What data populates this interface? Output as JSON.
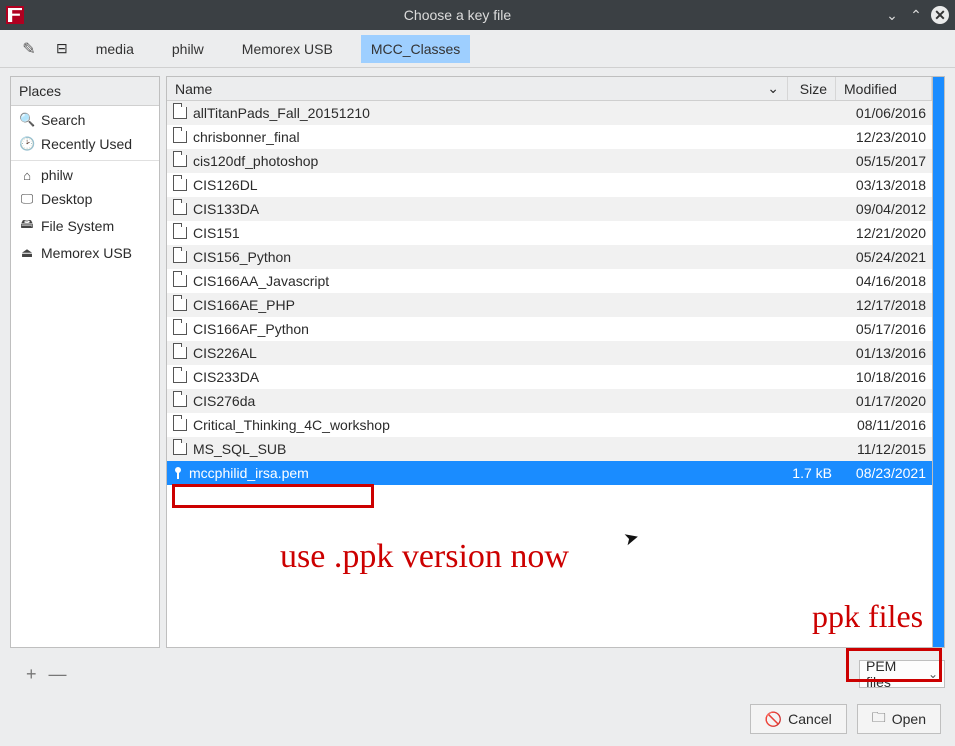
{
  "titlebar": {
    "title": "Choose a key file"
  },
  "breadcrumb": {
    "items": [
      "media",
      "philw",
      "Memorex USB",
      "MCC_Classes"
    ],
    "active_index": 3
  },
  "places": {
    "header": "Places",
    "items": [
      {
        "icon": "search-icon",
        "label": "Search"
      },
      {
        "icon": "recent-icon",
        "label": "Recently Used"
      },
      {
        "icon": "home-icon",
        "label": "philw",
        "separator": true
      },
      {
        "icon": "desktop-icon",
        "label": "Desktop"
      },
      {
        "icon": "filesystem-icon",
        "label": "File System"
      },
      {
        "icon": "usb-icon",
        "label": "Memorex USB"
      }
    ]
  },
  "filelist": {
    "columns": {
      "name": "Name",
      "size": "Size",
      "modified": "Modified"
    },
    "rows": [
      {
        "type": "folder",
        "name": "allTitanPads_Fall_20151210",
        "size": "",
        "modified": "01/06/2016"
      },
      {
        "type": "folder",
        "name": "chrisbonner_final",
        "size": "",
        "modified": "12/23/2010"
      },
      {
        "type": "folder",
        "name": "cis120df_photoshop",
        "size": "",
        "modified": "05/15/2017"
      },
      {
        "type": "folder",
        "name": "CIS126DL",
        "size": "",
        "modified": "03/13/2018"
      },
      {
        "type": "folder",
        "name": "CIS133DA",
        "size": "",
        "modified": "09/04/2012"
      },
      {
        "type": "folder",
        "name": "CIS151",
        "size": "",
        "modified": "12/21/2020"
      },
      {
        "type": "folder",
        "name": "CIS156_Python",
        "size": "",
        "modified": "05/24/2021"
      },
      {
        "type": "folder",
        "name": "CIS166AA_Javascript",
        "size": "",
        "modified": "04/16/2018"
      },
      {
        "type": "folder",
        "name": "CIS166AE_PHP",
        "size": "",
        "modified": "12/17/2018"
      },
      {
        "type": "folder",
        "name": "CIS166AF_Python",
        "size": "",
        "modified": "05/17/2016"
      },
      {
        "type": "folder",
        "name": "CIS226AL",
        "size": "",
        "modified": "01/13/2016"
      },
      {
        "type": "folder",
        "name": "CIS233DA",
        "size": "",
        "modified": "10/18/2016"
      },
      {
        "type": "folder",
        "name": "CIS276da",
        "size": "",
        "modified": "01/17/2020"
      },
      {
        "type": "folder",
        "name": "Critical_Thinking_4C_workshop",
        "size": "",
        "modified": "08/11/2016"
      },
      {
        "type": "folder",
        "name": "MS_SQL_SUB",
        "size": "",
        "modified": "11/12/2015"
      },
      {
        "type": "key",
        "name": "mccphilid_irsa.pem",
        "size": "1.7 kB",
        "modified": "08/23/2021",
        "selected": true
      }
    ]
  },
  "filter": {
    "label": "PEM files"
  },
  "buttons": {
    "cancel": "Cancel",
    "open": "Open"
  },
  "annotations": {
    "main_note": "use .ppk version now",
    "filter_note": "ppk files"
  }
}
